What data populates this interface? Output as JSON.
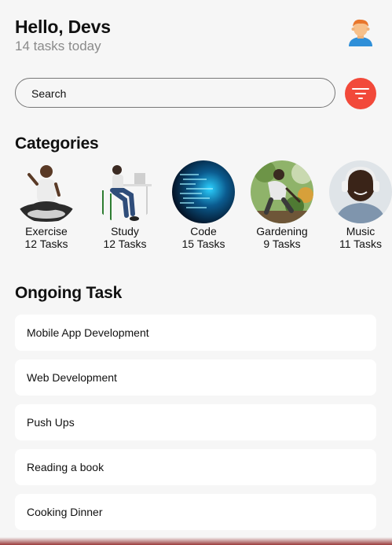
{
  "header": {
    "greeting": "Hello, Devs",
    "subtitle": "14 tasks today",
    "avatar_icon": "person-avatar-icon"
  },
  "search": {
    "placeholder": "Search",
    "filter_icon": "filter-icon",
    "filter_color": "#f2493a"
  },
  "categories": {
    "title": "Categories",
    "items": [
      {
        "name": "Exercise",
        "count": "12 Tasks"
      },
      {
        "name": "Study",
        "count": "12 Tasks"
      },
      {
        "name": "Code",
        "count": "15 Tasks"
      },
      {
        "name": "Gardening",
        "count": "9 Tasks"
      },
      {
        "name": "Music",
        "count": "11 Tasks"
      }
    ]
  },
  "ongoing": {
    "title": "Ongoing Task",
    "tasks": [
      {
        "label": "Mobile App Development"
      },
      {
        "label": "Web Development"
      },
      {
        "label": "Push Ups"
      },
      {
        "label": "Reading a book"
      },
      {
        "label": "Cooking Dinner"
      }
    ]
  }
}
